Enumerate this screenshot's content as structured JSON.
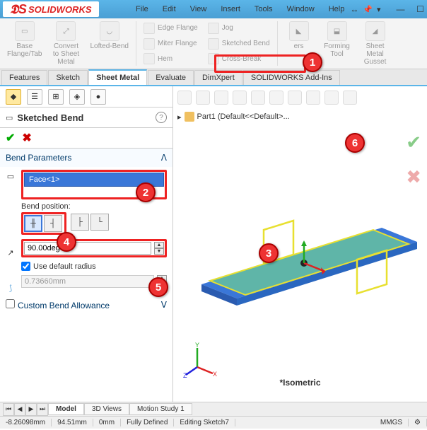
{
  "app": {
    "name": "SOLIDWORKS"
  },
  "menus": [
    "File",
    "Edit",
    "View",
    "Insert",
    "Tools",
    "Window",
    "Help"
  ],
  "ribbon": {
    "sheet": {
      "baseFlange": "Base\nFlange/Tab",
      "convert": "Convert\nto Sheet\nMetal",
      "lofted": "Lofted-Bend",
      "forming": "Forming\nTool",
      "gusset": "Sheet\nMetal\nGusset"
    },
    "col1": [
      "Edge Flange",
      "Miter Flange",
      "Hem"
    ],
    "col2": [
      "Jog",
      "Sketched Bend",
      "Cross-Break"
    ]
  },
  "tabs": [
    "Features",
    "Sketch",
    "Sheet Metal",
    "Evaluate",
    "DimXpert",
    "SOLIDWORKS Add-Ins"
  ],
  "activeTab": "Sheet Metal",
  "panel": {
    "title": "Sketched Bend",
    "section": "Bend Parameters",
    "face": "Face<1>",
    "bendPosLabel": "Bend position:",
    "angle": "90.00deg",
    "useDefaultRadius": "Use default radius",
    "radius": "0.73660mm",
    "customAllowance": "Custom Bend Allowance"
  },
  "tree": {
    "part": "Part1  (Default<<Default>..."
  },
  "viewport": {
    "isometric": "*Isometric"
  },
  "bottomTabs": [
    "Model",
    "3D Views",
    "Motion Study 1"
  ],
  "status": {
    "x": "-8.26098mm",
    "y": "94.51mm",
    "z": "0mm",
    "defined": "Fully Defined",
    "editing": "Editing Sketch7",
    "units": "MMGS"
  }
}
